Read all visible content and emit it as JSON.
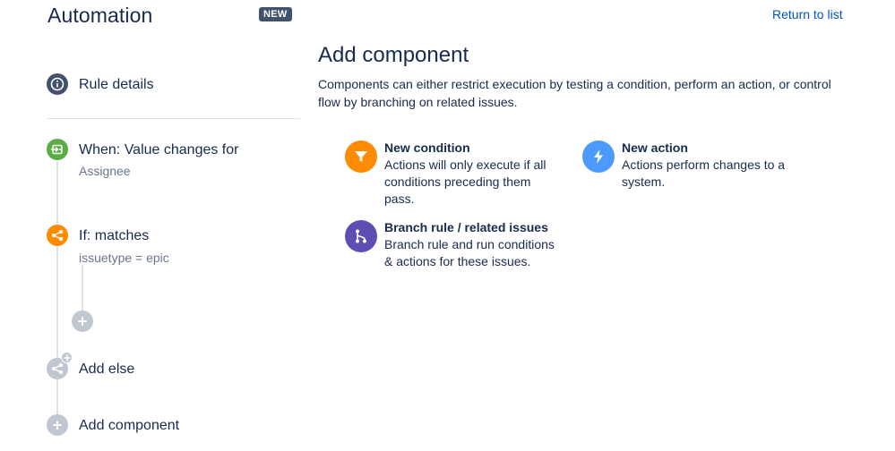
{
  "header": {
    "title": "Automation",
    "badge": "NEW",
    "return_link": "Return to list"
  },
  "sidebar": {
    "rule_details": {
      "label": "Rule details",
      "icon": "info-icon"
    },
    "trigger": {
      "label": "When: Value changes for",
      "sub": "Assignee",
      "icon": "trigger-icon"
    },
    "condition": {
      "label": "If: matches",
      "sub": "issuetype = epic",
      "icon": "branch-share-icon"
    },
    "add_else": {
      "label": "Add else",
      "icon": "branch-share-icon"
    },
    "add_component": {
      "label": "Add component",
      "icon": "plus-icon"
    }
  },
  "panel": {
    "title": "Add component",
    "description": "Components can either restrict execution by testing a condition, perform an action, or control flow by branching on related issues.",
    "options": [
      {
        "title": "New condition",
        "description": "Actions will only execute if all conditions preceding them pass.",
        "icon": "funnel-icon",
        "color": "#ff8b00"
      },
      {
        "title": "New action",
        "description": "Actions perform changes to a system.",
        "icon": "lightning-bolt-icon",
        "color": "#4c9aff"
      },
      {
        "title": "Branch rule / related issues",
        "description": "Branch rule and run conditions & actions for these issues.",
        "icon": "branch-icon",
        "color": "#5e4db2"
      }
    ]
  },
  "colors": {
    "link": "#0052cc",
    "text": "#172b4d",
    "muted": "#6b778c",
    "trigger_green": "#5aac44",
    "condition_orange": "#ff8b00",
    "neutral_dark": "#42526e",
    "disabled_gray": "#c1c7d0"
  }
}
